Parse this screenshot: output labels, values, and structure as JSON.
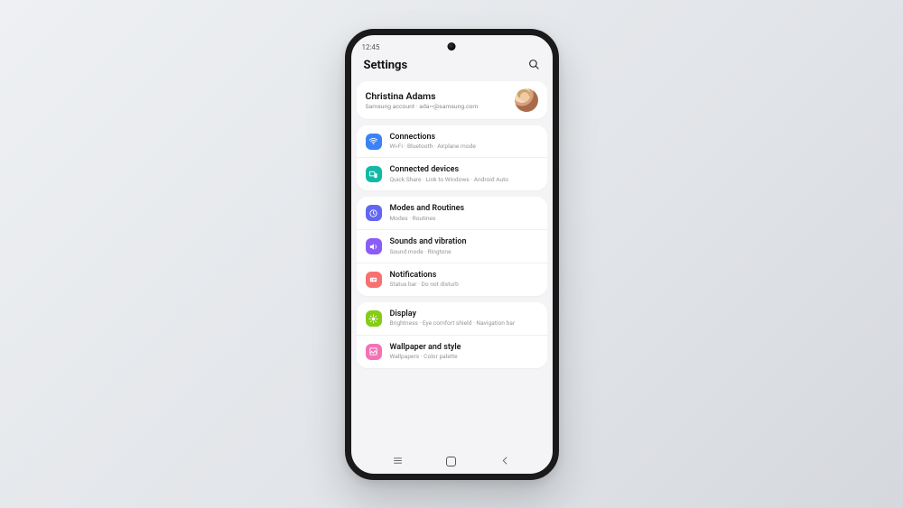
{
  "status": {
    "time": "12:45"
  },
  "header": {
    "title": "Settings"
  },
  "account": {
    "name": "Christina Adams",
    "subtitle": "Samsung account · ada••@samsung.com"
  },
  "groups": [
    {
      "items": [
        {
          "icon": "wifi",
          "color": "c-blue",
          "name": "connections",
          "title": "Connections",
          "subtitle": "Wi-Fi · Bluetooth · Airplane mode"
        },
        {
          "icon": "devices",
          "color": "c-teal",
          "name": "connected-devices",
          "title": "Connected devices",
          "subtitle": "Quick Share · Link to Windows · Android Auto"
        }
      ]
    },
    {
      "items": [
        {
          "icon": "routines",
          "color": "c-indigo",
          "name": "modes-routines",
          "title": "Modes and Routines",
          "subtitle": "Modes · Routines"
        },
        {
          "icon": "sound",
          "color": "c-purple",
          "name": "sounds-vibration",
          "title": "Sounds and vibration",
          "subtitle": "Sound mode · Ringtone"
        },
        {
          "icon": "bell",
          "color": "c-coral",
          "name": "notifications",
          "title": "Notifications",
          "subtitle": "Status bar · Do not disturb"
        }
      ]
    },
    {
      "items": [
        {
          "icon": "sun",
          "color": "c-lime",
          "name": "display",
          "title": "Display",
          "subtitle": "Brightness · Eye comfort shield · Navigation bar"
        },
        {
          "icon": "wallpaper",
          "color": "c-pink",
          "name": "wallpaper-style",
          "title": "Wallpaper and style",
          "subtitle": "Wallpapers · Color palette"
        }
      ]
    }
  ]
}
